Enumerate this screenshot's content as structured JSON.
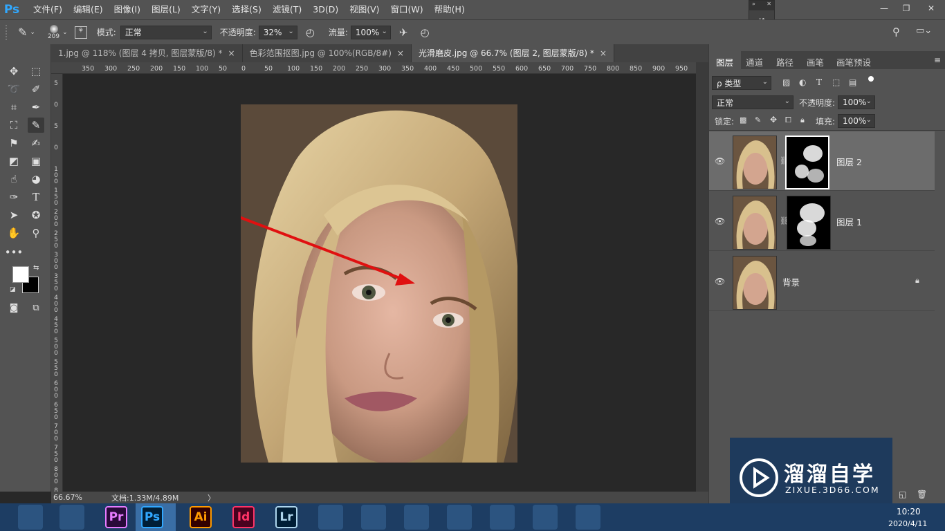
{
  "app": {
    "logo": "Ps"
  },
  "menu": [
    "文件(F)",
    "编辑(E)",
    "图像(I)",
    "图层(L)",
    "文字(Y)",
    "选择(S)",
    "滤镜(T)",
    "3D(D)",
    "视图(V)",
    "窗口(W)",
    "帮助(H)"
  ],
  "options": {
    "brush_size": "209",
    "mode_label": "模式:",
    "mode_value": "正常",
    "opacity_label": "不透明度:",
    "opacity_value": "32%",
    "flow_label": "流量:",
    "flow_value": "100%"
  },
  "tabs": [
    {
      "label": "1.jpg @ 118% (图层 4 拷贝, 图层蒙版/8) *",
      "close": "×"
    },
    {
      "label": "色彩范围抠图.jpg @ 100%(RGB/8#)",
      "close": "×"
    },
    {
      "label": "光滑磨皮.jpg @ 66.7% (图层 2, 图层蒙版/8) *",
      "close": "×"
    }
  ],
  "ruler_top": [
    "350",
    "300",
    "250",
    "200",
    "150",
    "100",
    "50",
    "0",
    "50",
    "100",
    "150",
    "200",
    "250",
    "300",
    "350",
    "400",
    "450",
    "500",
    "550",
    "600",
    "650",
    "700",
    "750",
    "800",
    "850",
    "900",
    "950"
  ],
  "ruler_left": [
    "5",
    "0",
    "5",
    "0",
    "1 0 0",
    "1 5 0",
    "2 0 0",
    "2 5 0",
    "3 0 0",
    "3 5 0",
    "4 0 0",
    "4 5 0",
    "5 0 0",
    "5 5 0",
    "6 0 0",
    "6 5 0",
    "7 0 0",
    "7 5 0",
    "8 0 0",
    "8 5 0"
  ],
  "status": {
    "zoom": "66.67%",
    "doc": "文档:1.33M/4.89M",
    "arrow": "〉"
  },
  "panel": {
    "tabs": [
      "图层",
      "通道",
      "路径",
      "画笔",
      "画笔预设"
    ],
    "kind_label": "ρ 类型",
    "blend_mode": "正常",
    "opacity_label": "不透明度:",
    "opacity_value": "100%",
    "lock_label": "锁定:",
    "fill_label": "填充:",
    "fill_value": "100%",
    "layers": [
      {
        "name": "图层 2",
        "selected": true,
        "has_mask": true
      },
      {
        "name": "图层 1",
        "selected": false,
        "has_mask": true
      },
      {
        "name": "背景",
        "selected": false,
        "has_mask": false,
        "locked": true
      }
    ]
  },
  "taskbar": {
    "apps": [
      {
        "name": "ie-icon",
        "label": ""
      },
      {
        "name": "explorer-icon",
        "label": ""
      },
      {
        "name": "premiere-icon",
        "label": "Pr",
        "color": "#e77cff",
        "bg": "#2a0a3a"
      },
      {
        "name": "photoshop-icon",
        "label": "Ps",
        "color": "#31a8ff",
        "bg": "#001e36"
      },
      {
        "name": "illustrator-icon",
        "label": "Ai",
        "color": "#ff9a00",
        "bg": "#330000"
      },
      {
        "name": "indesign-icon",
        "label": "Id",
        "color": "#ff3366",
        "bg": "#49021f"
      },
      {
        "name": "lightroom-icon",
        "label": "Lr",
        "color": "#add5ec",
        "bg": "#001e36"
      },
      {
        "name": "film-icon",
        "label": ""
      },
      {
        "name": "pinwheel-icon",
        "label": ""
      },
      {
        "name": "bird-icon",
        "label": ""
      },
      {
        "name": "qq-icon",
        "label": ""
      },
      {
        "name": "chrome-icon",
        "label": ""
      },
      {
        "name": "swift-icon",
        "label": ""
      },
      {
        "name": "notepad-icon",
        "label": ""
      }
    ],
    "time": "10:20",
    "date": "2020/4/11"
  },
  "watermark": {
    "title": "溜溜自学",
    "url": "ZIXUE.3D66.COM"
  }
}
